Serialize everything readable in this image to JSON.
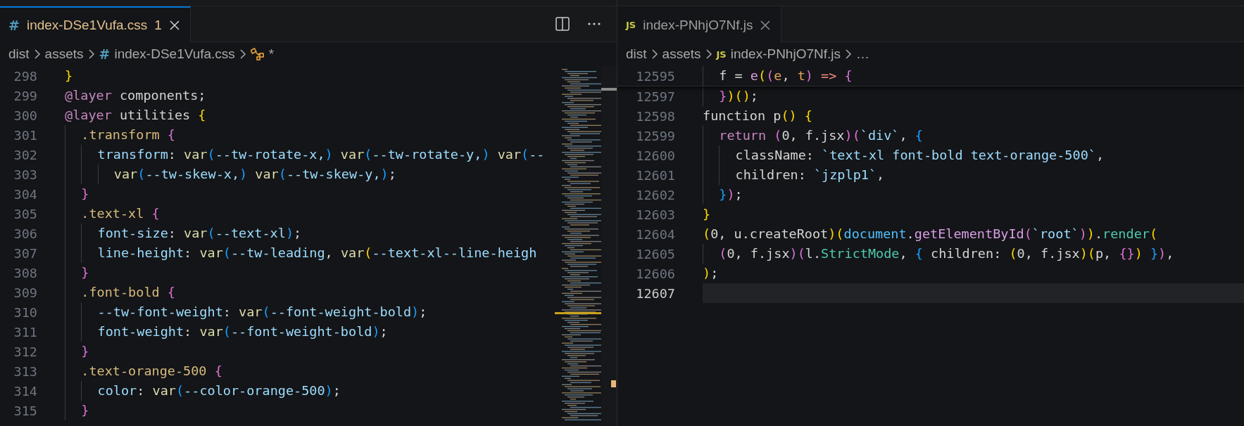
{
  "editor_groups": [
    {
      "focused": true,
      "tab": {
        "icon": {
          "kind": "css",
          "glyph": "#"
        },
        "label": "index-DSe1Vufa.css",
        "badge": "1",
        "selected": true
      },
      "breadcrumbs": [
        {
          "kind": "folder",
          "label": "dist"
        },
        {
          "kind": "folder",
          "label": "assets"
        },
        {
          "kind": "file",
          "icon": {
            "kind": "css",
            "glyph": "#"
          },
          "label": "index-DSe1Vufa.css"
        },
        {
          "kind": "symbol",
          "label": "*"
        }
      ],
      "minimap": true,
      "lines": [
        {
          "number": "298",
          "tokens": [
            {
              "kind": "b1",
              "text": "}"
            }
          ]
        },
        {
          "number": "299",
          "tokens": [
            {
              "kind": "kw",
              "text": "@layer"
            },
            {
              "kind": "p",
              "text": " components;"
            }
          ]
        },
        {
          "number": "300",
          "tokens": [
            {
              "kind": "kw",
              "text": "@layer"
            },
            {
              "kind": "p",
              "text": " utilities "
            },
            {
              "kind": "b1",
              "text": "{"
            }
          ]
        },
        {
          "number": "301",
          "tokens": [
            {
              "kind": "sel",
              "text": "  .transform "
            },
            {
              "kind": "b2",
              "text": "{"
            }
          ]
        },
        {
          "number": "302",
          "tokens": [
            {
              "kind": "prop",
              "text": "    transform"
            },
            {
              "kind": "p",
              "text": ": "
            },
            {
              "kind": "fn",
              "text": "var"
            },
            {
              "kind": "b3",
              "text": "("
            },
            {
              "kind": "var",
              "text": "--tw-rotate-x,"
            },
            {
              "kind": "b3",
              "text": ")"
            },
            {
              "kind": "fn",
              "text": " var"
            },
            {
              "kind": "b3",
              "text": "("
            },
            {
              "kind": "var",
              "text": "--tw-rotate-y,"
            },
            {
              "kind": "b3",
              "text": ")"
            },
            {
              "kind": "fn",
              "text": " var"
            },
            {
              "kind": "b3",
              "text": "("
            },
            {
              "kind": "var",
              "text": "--"
            }
          ]
        },
        {
          "number": "303",
          "tokens": [
            {
              "kind": "fn",
              "text": "      var"
            },
            {
              "kind": "b3",
              "text": "("
            },
            {
              "kind": "var",
              "text": "--tw-skew-x,"
            },
            {
              "kind": "b3",
              "text": ")"
            },
            {
              "kind": "fn",
              "text": " var"
            },
            {
              "kind": "b3",
              "text": "("
            },
            {
              "kind": "var",
              "text": "--tw-skew-y,"
            },
            {
              "kind": "b3",
              "text": ")"
            },
            {
              "kind": "p",
              "text": ";"
            }
          ]
        },
        {
          "number": "304",
          "tokens": [
            {
              "kind": "b2",
              "text": "  }"
            }
          ]
        },
        {
          "number": "305",
          "tokens": [
            {
              "kind": "sel",
              "text": "  .text-xl "
            },
            {
              "kind": "b2",
              "text": "{"
            }
          ]
        },
        {
          "number": "306",
          "tokens": [
            {
              "kind": "prop",
              "text": "    font-size"
            },
            {
              "kind": "p",
              "text": ": "
            },
            {
              "kind": "fn",
              "text": "var"
            },
            {
              "kind": "b3",
              "text": "("
            },
            {
              "kind": "var",
              "text": "--text-xl"
            },
            {
              "kind": "b3",
              "text": ")"
            },
            {
              "kind": "p",
              "text": ";"
            }
          ]
        },
        {
          "number": "307",
          "tokens": [
            {
              "kind": "prop",
              "text": "    line-height"
            },
            {
              "kind": "p",
              "text": ": "
            },
            {
              "kind": "fn",
              "text": "var"
            },
            {
              "kind": "b3",
              "text": "("
            },
            {
              "kind": "var",
              "text": "--tw-leading"
            },
            {
              "kind": "p",
              "text": ", "
            },
            {
              "kind": "fn",
              "text": "var"
            },
            {
              "kind": "b1",
              "text": "("
            },
            {
              "kind": "var",
              "text": "--text-xl--line-heigh"
            }
          ]
        },
        {
          "number": "308",
          "tokens": [
            {
              "kind": "b2",
              "text": "  }"
            }
          ]
        },
        {
          "number": "309",
          "tokens": [
            {
              "kind": "sel",
              "text": "  .font-bold "
            },
            {
              "kind": "b2",
              "text": "{"
            }
          ]
        },
        {
          "number": "310",
          "tokens": [
            {
              "kind": "prop",
              "text": "    --tw-font-weight"
            },
            {
              "kind": "p",
              "text": ": "
            },
            {
              "kind": "fn",
              "text": "var"
            },
            {
              "kind": "b3",
              "text": "("
            },
            {
              "kind": "var",
              "text": "--font-weight-bold"
            },
            {
              "kind": "b3",
              "text": ")"
            },
            {
              "kind": "p",
              "text": ";"
            }
          ]
        },
        {
          "number": "311",
          "tokens": [
            {
              "kind": "prop",
              "text": "    font-weight"
            },
            {
              "kind": "p",
              "text": ": "
            },
            {
              "kind": "fn",
              "text": "var"
            },
            {
              "kind": "b3",
              "text": "("
            },
            {
              "kind": "var",
              "text": "--font-weight-bold"
            },
            {
              "kind": "b3",
              "text": ")"
            },
            {
              "kind": "p",
              "text": ";"
            }
          ]
        },
        {
          "number": "312",
          "tokens": [
            {
              "kind": "b2",
              "text": "  }"
            }
          ]
        },
        {
          "number": "313",
          "tokens": [
            {
              "kind": "sel",
              "text": "  .text-orange-500 "
            },
            {
              "kind": "b2",
              "text": "{"
            }
          ]
        },
        {
          "number": "314",
          "tokens": [
            {
              "kind": "prop",
              "text": "    color"
            },
            {
              "kind": "p",
              "text": ": "
            },
            {
              "kind": "fn",
              "text": "var"
            },
            {
              "kind": "b3",
              "text": "("
            },
            {
              "kind": "var",
              "text": "--color-orange-500"
            },
            {
              "kind": "b3",
              "text": ")"
            },
            {
              "kind": "p",
              "text": ";"
            }
          ]
        },
        {
          "number": "315",
          "tokens": [
            {
              "kind": "b2",
              "text": "  }"
            }
          ]
        }
      ]
    },
    {
      "focused": false,
      "tab": {
        "icon": {
          "kind": "js",
          "glyph": "JS"
        },
        "label": "index-PNhjO7Nf.js",
        "selected": true
      },
      "breadcrumbs": [
        {
          "kind": "folder",
          "label": "dist"
        },
        {
          "kind": "folder",
          "label": "assets"
        },
        {
          "kind": "file",
          "icon": {
            "kind": "js",
            "glyph": "JS"
          },
          "label": "index-PNhjO7Nf.js"
        },
        {
          "kind": "more",
          "label": "…"
        }
      ],
      "sticky_line": {
        "number": "12595",
        "tokens": [
          {
            "kind": "p",
            "text": "  f = "
          },
          {
            "kind": "mth",
            "text": "e"
          },
          {
            "kind": "b1",
            "text": "("
          },
          {
            "kind": "b2",
            "text": "("
          },
          {
            "kind": "param",
            "text": "e"
          },
          {
            "kind": "p",
            "text": ", "
          },
          {
            "kind": "param",
            "text": "t"
          },
          {
            "kind": "b2",
            "text": ")"
          },
          {
            "kind": "op",
            "text": " => "
          },
          {
            "kind": "b2",
            "text": "{"
          }
        ]
      },
      "lines": [
        {
          "number": "12597",
          "tokens": [
            {
              "kind": "b2",
              "text": "  }"
            },
            {
              "kind": "b1",
              "text": ")()"
            },
            {
              "kind": "p",
              "text": ";"
            }
          ]
        },
        {
          "number": "12598",
          "tokens": [
            {
              "kind": "p",
              "text": "function p"
            },
            {
              "kind": "b1",
              "text": "()"
            },
            {
              "kind": "b1",
              "text": " {"
            }
          ]
        },
        {
          "number": "12599",
          "tokens": [
            {
              "kind": "kw",
              "text": "  return"
            },
            {
              "kind": "b2",
              "text": " ("
            },
            {
              "kind": "p",
              "text": "0, f.jsx"
            },
            {
              "kind": "b2",
              "text": ")("
            },
            {
              "kind": "str",
              "text": "`div`"
            },
            {
              "kind": "p",
              "text": ", "
            },
            {
              "kind": "b3",
              "text": "{"
            }
          ]
        },
        {
          "number": "12600",
          "tokens": [
            {
              "kind": "p",
              "text": "    className: "
            },
            {
              "kind": "str",
              "text": "`text-xl font-bold text-orange-500`"
            },
            {
              "kind": "p",
              "text": ","
            }
          ]
        },
        {
          "number": "12601",
          "tokens": [
            {
              "kind": "p",
              "text": "    children: "
            },
            {
              "kind": "str",
              "text": "`jzplp1`"
            },
            {
              "kind": "p",
              "text": ","
            }
          ]
        },
        {
          "number": "12602",
          "tokens": [
            {
              "kind": "b3",
              "text": "  }"
            },
            {
              "kind": "b2",
              "text": ")"
            },
            {
              "kind": "p",
              "text": ";"
            }
          ]
        },
        {
          "number": "12603",
          "tokens": [
            {
              "kind": "b1",
              "text": "}"
            }
          ]
        },
        {
          "number": "12604",
          "tokens": [
            {
              "kind": "b1",
              "text": "("
            },
            {
              "kind": "p",
              "text": "0, u.createRoot"
            },
            {
              "kind": "b1",
              "text": ")("
            },
            {
              "kind": "obj",
              "text": "document"
            },
            {
              "kind": "p",
              "text": "."
            },
            {
              "kind": "mth",
              "text": "getElementById"
            },
            {
              "kind": "b2",
              "text": "("
            },
            {
              "kind": "str",
              "text": "`root`"
            },
            {
              "kind": "b2",
              "text": ")"
            },
            {
              "kind": "b1",
              "text": ")"
            },
            {
              "kind": "p",
              "text": "."
            },
            {
              "kind": "cls",
              "text": "render"
            },
            {
              "kind": "b1",
              "text": "("
            }
          ]
        },
        {
          "number": "12605",
          "tokens": [
            {
              "kind": "b2",
              "text": "  ("
            },
            {
              "kind": "p",
              "text": "0, f.jsx"
            },
            {
              "kind": "b2",
              "text": ")("
            },
            {
              "kind": "p",
              "text": "l."
            },
            {
              "kind": "cls",
              "text": "StrictMode"
            },
            {
              "kind": "p",
              "text": ", "
            },
            {
              "kind": "b3",
              "text": "{"
            },
            {
              "kind": "p",
              "text": " children: "
            },
            {
              "kind": "b1",
              "text": "("
            },
            {
              "kind": "p",
              "text": "0, f.jsx"
            },
            {
              "kind": "b1",
              "text": ")("
            },
            {
              "kind": "p",
              "text": "p, "
            },
            {
              "kind": "b2",
              "text": "{}"
            },
            {
              "kind": "b1",
              "text": ")"
            },
            {
              "kind": "b3",
              "text": " }"
            },
            {
              "kind": "b2",
              "text": ")"
            },
            {
              "kind": "p",
              "text": ","
            }
          ]
        },
        {
          "number": "12606",
          "tokens": [
            {
              "kind": "b1",
              "text": ")"
            },
            {
              "kind": "p",
              "text": ";"
            }
          ]
        },
        {
          "number": "12607",
          "current": true
        }
      ]
    }
  ]
}
